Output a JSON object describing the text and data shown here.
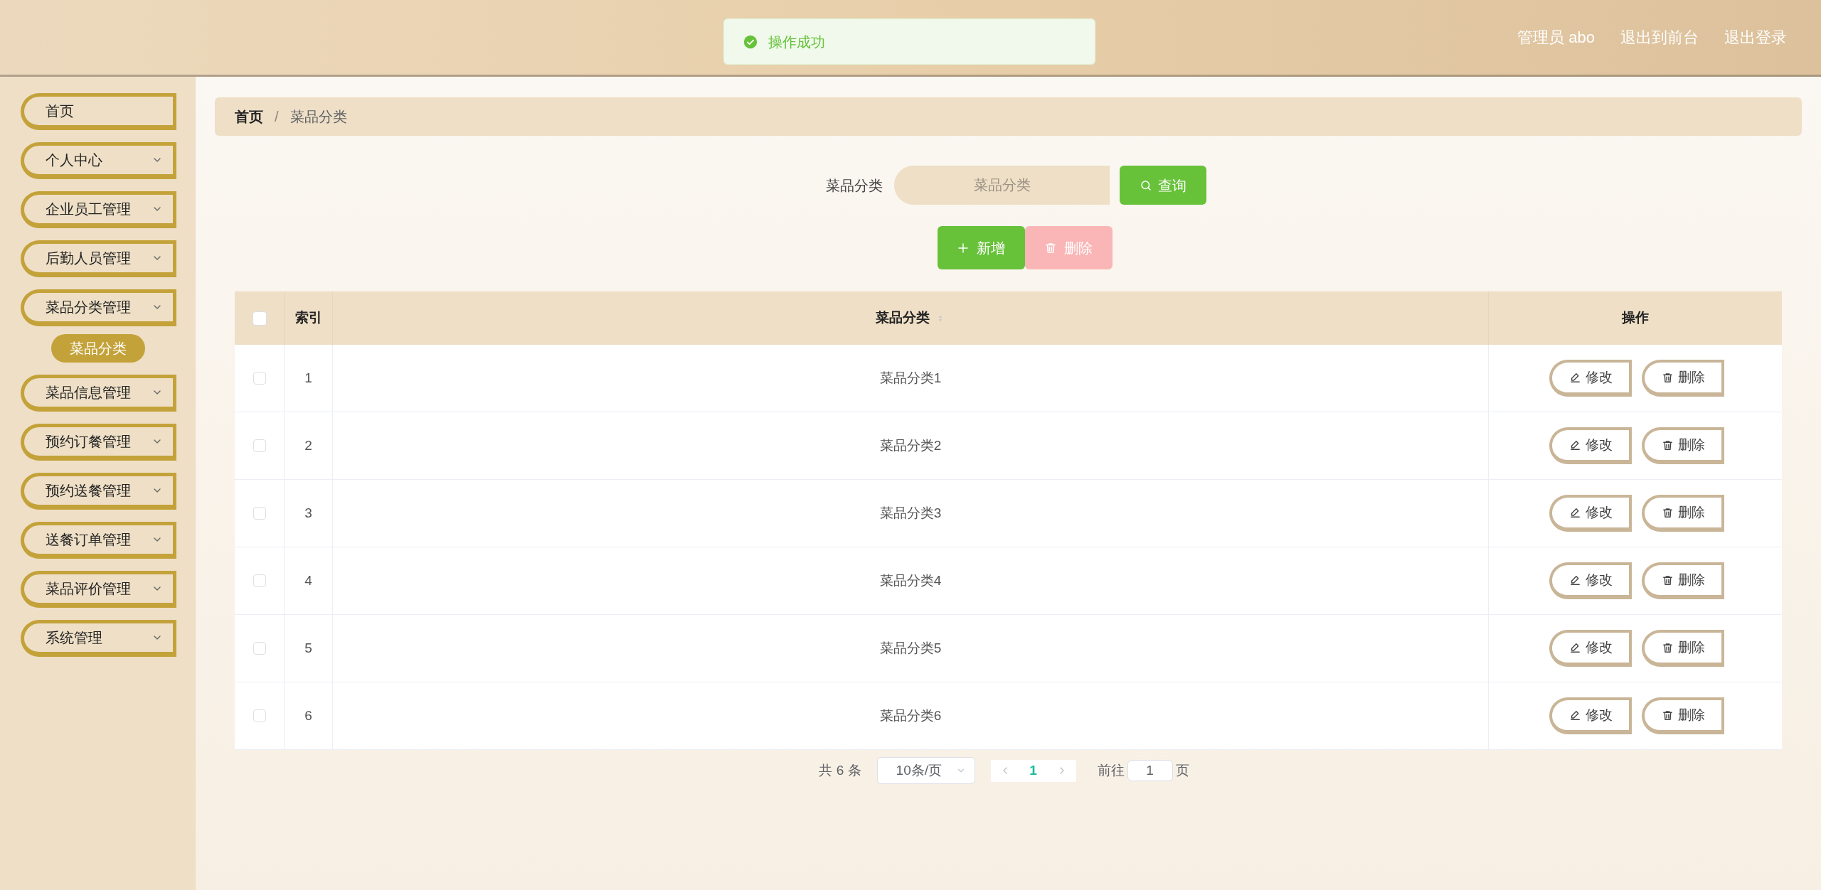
{
  "toast": {
    "kind": "success",
    "message": "操作成功"
  },
  "header": {
    "user": "管理员 abo",
    "links": [
      "退出到前台",
      "退出登录"
    ]
  },
  "sidebar": {
    "items": [
      {
        "label": "首页",
        "expandable": false
      },
      {
        "label": "个人中心",
        "expandable": true
      },
      {
        "label": "企业员工管理",
        "expandable": true
      },
      {
        "label": "后勤人员管理",
        "expandable": true
      },
      {
        "label": "菜品分类管理",
        "expandable": true,
        "children": [
          {
            "label": "菜品分类",
            "selected": true
          }
        ]
      },
      {
        "label": "菜品信息管理",
        "expandable": true
      },
      {
        "label": "预约订餐管理",
        "expandable": true
      },
      {
        "label": "预约送餐管理",
        "expandable": true
      },
      {
        "label": "送餐订单管理",
        "expandable": true
      },
      {
        "label": "菜品评价管理",
        "expandable": true
      },
      {
        "label": "系统管理",
        "expandable": true
      }
    ]
  },
  "breadcrumb": {
    "items": [
      "首页",
      "菜品分类"
    ],
    "separator": "/"
  },
  "search": {
    "label": "菜品分类",
    "placeholder": "菜品分类",
    "button": "查询"
  },
  "actions": [
    {
      "kind": "add",
      "label": "新增",
      "disabled": false
    },
    {
      "kind": "delete",
      "label": "删除",
      "disabled": true
    }
  ],
  "table": {
    "columns": [
      "索引",
      "菜品分类",
      "操作"
    ],
    "all_checked": false,
    "rows": [
      {
        "index": "1",
        "name": "菜品分类1",
        "checked": false,
        "actions": [
          "修改",
          "删除"
        ]
      },
      {
        "index": "2",
        "name": "菜品分类2",
        "checked": false,
        "actions": [
          "修改",
          "删除"
        ]
      },
      {
        "index": "3",
        "name": "菜品分类3",
        "checked": false,
        "actions": [
          "修改",
          "删除"
        ]
      },
      {
        "index": "4",
        "name": "菜品分类4",
        "checked": false,
        "actions": [
          "修改",
          "删除"
        ]
      },
      {
        "index": "5",
        "name": "菜品分类5",
        "checked": false,
        "actions": [
          "修改",
          "删除"
        ]
      },
      {
        "index": "6",
        "name": "菜品分类6",
        "checked": false,
        "actions": [
          "修改",
          "删除"
        ]
      }
    ]
  },
  "pagination": {
    "total": "共 6 条",
    "page_size": "10条/页",
    "pages": [
      {
        "label": "1",
        "selected": true
      }
    ],
    "goto_label": "前往",
    "goto_value": "1",
    "goto_suffix": "页"
  }
}
